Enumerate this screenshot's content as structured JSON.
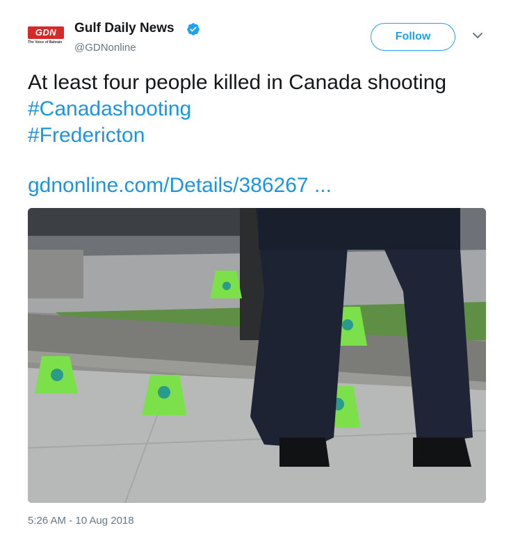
{
  "account": {
    "logo_text": "GDN",
    "logo_tagline": "The Voice of Bahrain",
    "display_name": "Gulf Daily News",
    "handle": "@GDNonline",
    "verified": true
  },
  "follow_label": "Follow",
  "tweet": {
    "text": "At least four people killed in Canada shooting",
    "hashtags": [
      "#Canadashooting",
      "#Fredericton"
    ],
    "link": "gdnonline.com/Details/386267  ..."
  },
  "timestamp": "5:26 AM - 10 Aug 2018",
  "icons": {
    "verified": "verified-badge-icon",
    "caret": "chevron-down-icon"
  },
  "colors": {
    "accent": "#1da1f2",
    "link": "#1b95e0",
    "secondary_text": "#657786",
    "brand_red": "#d42a2a",
    "marker_green": "#7be04a"
  }
}
